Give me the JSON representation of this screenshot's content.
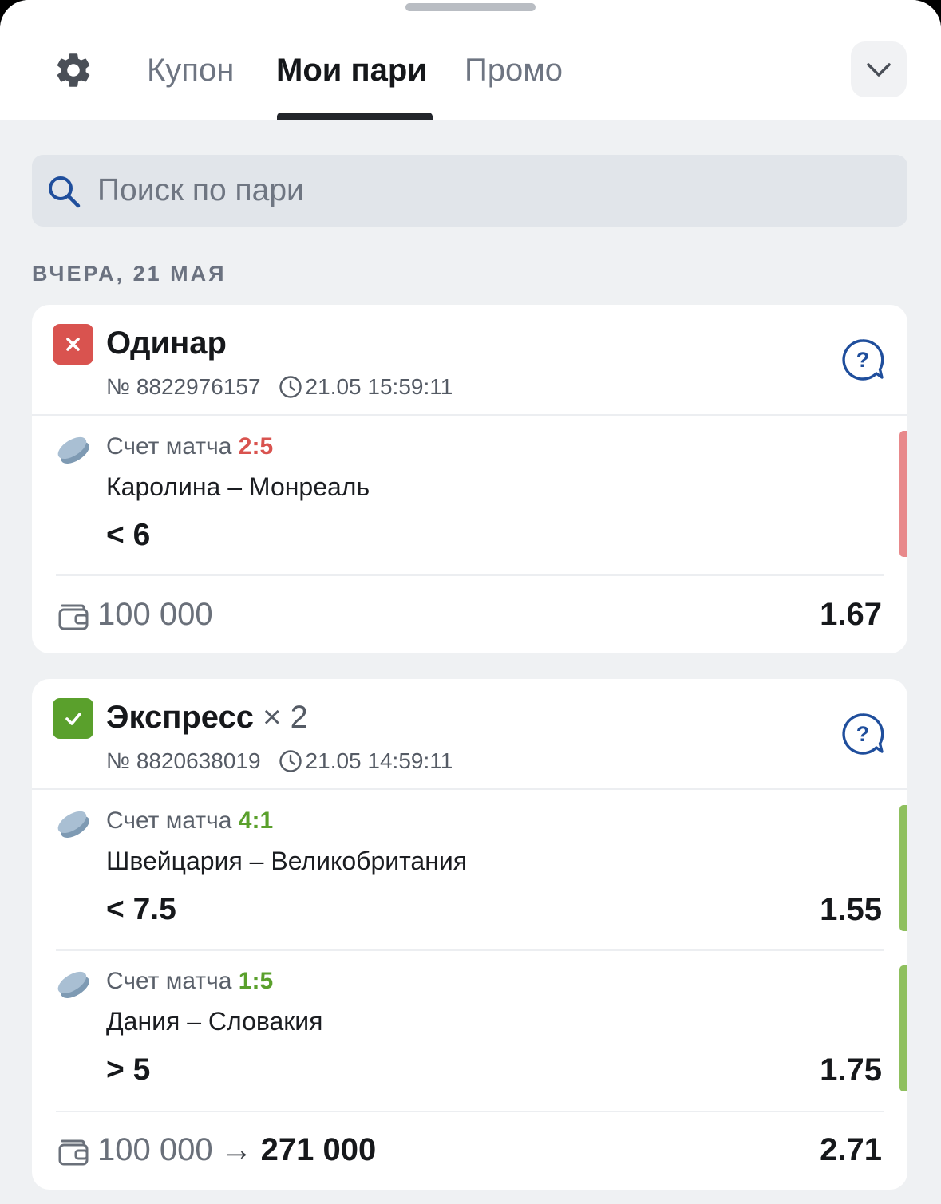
{
  "tabs": [
    {
      "label": "Купон"
    },
    {
      "label": "Мои пари"
    },
    {
      "label": "Промо"
    }
  ],
  "search": {
    "placeholder": "Поиск по пари"
  },
  "date_header": "ВЧЕРА, 21 МАЯ",
  "colors": {
    "lost": "#d9534f",
    "won": "#5aa02c",
    "lost_bar": "#e8898b",
    "won_bar": "#8fc05e"
  },
  "bets": [
    {
      "type": "Одинар",
      "status": "lost",
      "number": "№ 8822976157",
      "time": "21.05 15:59:11",
      "legs": [
        {
          "score_label": "Счет матча",
          "score": "2:5",
          "match": "Каролина – Монреаль",
          "pick": "< 6"
        }
      ],
      "stake": "100 000",
      "odds": "1.67"
    },
    {
      "type": "Экспресс",
      "multiplier": "× 2",
      "status": "won",
      "number": "№ 8820638019",
      "time": "21.05 14:59:11",
      "legs": [
        {
          "score_label": "Счет матча",
          "score": "4:1",
          "match": "Швейцария – Великобритания",
          "pick": "< 7.5",
          "odds": "1.55"
        },
        {
          "score_label": "Счет матча",
          "score": "1:5",
          "match": "Дания – Словакия",
          "pick": "> 5",
          "odds": "1.75"
        }
      ],
      "stake": "100 000",
      "arrow": "→",
      "payout": "271 000",
      "odds": "2.71"
    }
  ]
}
